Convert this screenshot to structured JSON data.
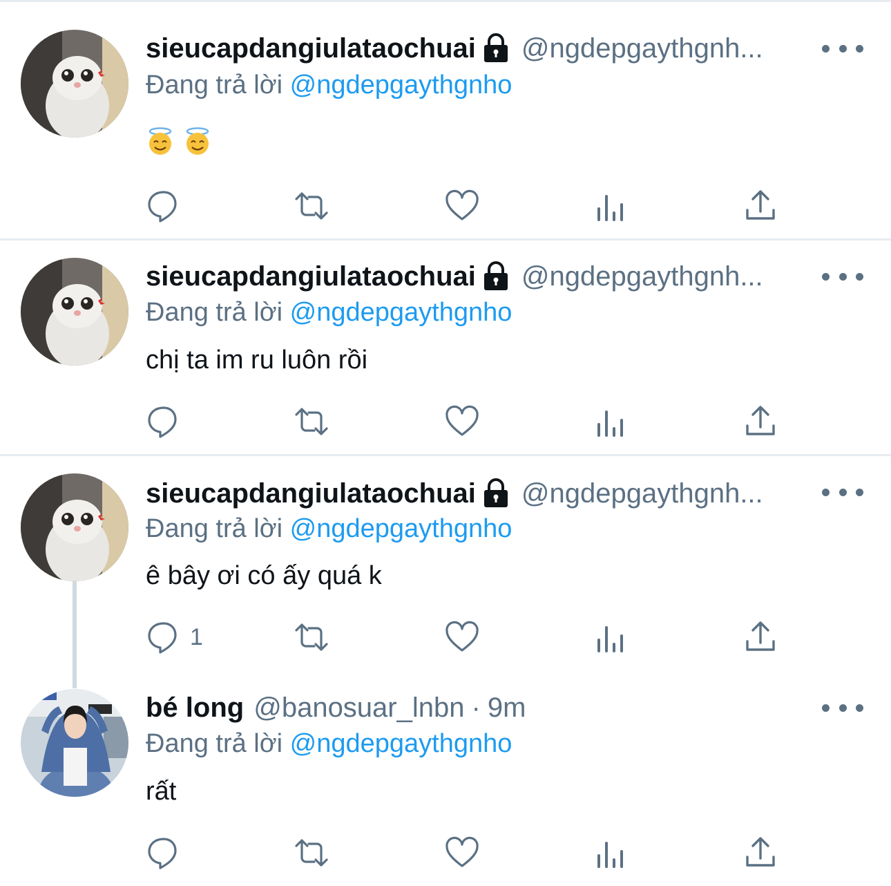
{
  "tweets": [
    {
      "name": "sieucapdangiulataochuai",
      "handle": "@ngdepgaythgnh...",
      "replying_label": "Đang trả lời",
      "replying_to": "@ngdepgaythgnho",
      "text": "",
      "emojis": [
        "smiling-face-with-halo",
        "smiling-face-with-halo"
      ],
      "reply_count": ""
    },
    {
      "name": "sieucapdangiulataochuai",
      "handle": "@ngdepgaythgnh...",
      "replying_label": "Đang trả lời",
      "replying_to": "@ngdepgaythgnho",
      "text": "chị ta im ru luôn rồi",
      "reply_count": ""
    },
    {
      "name": "sieucapdangiulataochuai",
      "handle": "@ngdepgaythgnh...",
      "replying_label": "Đang trả lời",
      "replying_to": "@ngdepgaythgnho",
      "text": "ê bây ơi có ấy quá k",
      "reply_count": "1"
    },
    {
      "name": "bé long",
      "handle": "@banosuar_lnbn",
      "separator": "·",
      "time": "9m",
      "replying_label": "Đang trả lời",
      "replying_to": "@ngdepgaythgnho",
      "text": "rất",
      "reply_count": ""
    }
  ],
  "icons": {
    "reply": "reply-icon",
    "retweet": "retweet-icon",
    "like": "like-icon",
    "analytics": "analytics-icon",
    "share": "share-icon",
    "more": "more-icon",
    "lock": "lock-icon"
  },
  "colors": {
    "link": "#1d9bf0",
    "muted": "#5b7083",
    "text": "#0f1419",
    "divider": "#e6ecf0"
  }
}
